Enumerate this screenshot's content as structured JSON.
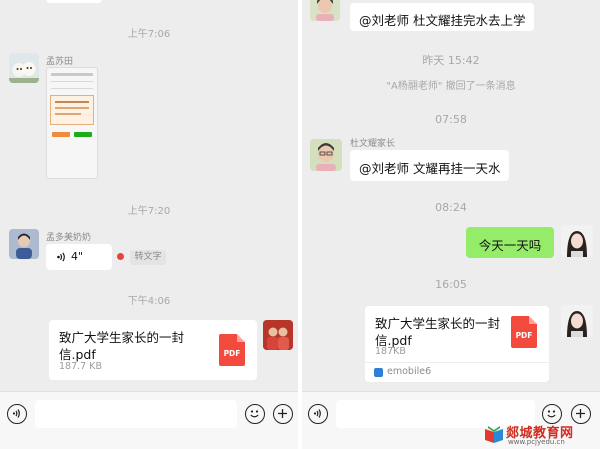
{
  "left": {
    "time_1": "上午7:06",
    "sender_1": "孟苏田",
    "sender_2": "孟多美奶奶",
    "time_2": "上午7:20",
    "voice_duration": "4\"",
    "convert_text_label": "转文字",
    "time_3": "下午4:06",
    "file": {
      "name": "致广大学生家长的一封信.pdf",
      "size": "187.7 KB",
      "type_label": "PDF"
    }
  },
  "right": {
    "msg_top": "@刘老师 杜文耀挂完水去上学",
    "time_1": "昨天 15:42",
    "recall_notice": "\"A杨翮老师\" 撤回了一条消息",
    "time_2": "07:58",
    "sender_1": "杜文耀家长",
    "msg_1": "@刘老师 文耀再挂一天水",
    "time_3": "08:24",
    "msg_self": "今天一天吗",
    "time_4": "16:05",
    "file": {
      "name": "致广大学生家长的一封信.pdf",
      "size": "187KB",
      "type_label": "PDF",
      "source": "emobile6"
    }
  },
  "watermark": {
    "brand": "郯城教育网",
    "url": "www.pcjyedu.cn"
  },
  "icons": {
    "voice_toggle": "voice-icon",
    "emoji": "emoji-icon",
    "add": "plus-icon",
    "pdf": "pdf-file-icon",
    "app": "emobile-app-icon",
    "voice_wave": "voice-wave-icon",
    "unread_dot": "red-dot-icon"
  },
  "colors": {
    "chat_bg": "#ededed",
    "self_bubble": "#95ec69",
    "pdf_red": "#f24b3e",
    "unread_dot": "#e64340"
  }
}
